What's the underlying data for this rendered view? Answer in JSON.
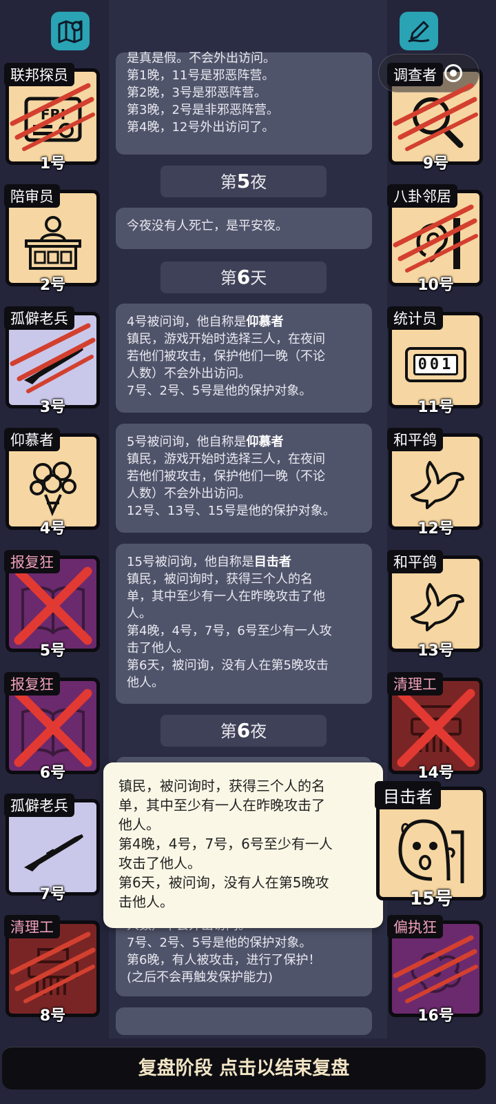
{
  "top": {
    "left_icon": "map-icon",
    "right_icon": "note-edit-icon"
  },
  "capsule": {
    "dots": "•••"
  },
  "cards_left": [
    {
      "label": "联邦探员",
      "num": "1号",
      "art": "fbi-badge-icon",
      "bg": "#f6d6a2",
      "state": "scratched"
    },
    {
      "label": "陪审员",
      "num": "2号",
      "art": "juror-icon",
      "bg": "#f6d6a2",
      "state": "normal"
    },
    {
      "label": "孤僻老兵",
      "num": "3号",
      "art": "rifle-icon",
      "bg": "#c9c8ea",
      "state": "scratched"
    },
    {
      "label": "仰慕者",
      "num": "4号",
      "art": "flower-bouquet-icon",
      "bg": "#f6d6a2",
      "state": "normal"
    },
    {
      "label": "报复狂",
      "num": "5号",
      "art": "book-icon",
      "bg": "#6b2a6d",
      "state": "crossed"
    },
    {
      "label": "报复狂",
      "num": "6号",
      "art": "book-icon",
      "bg": "#6b2a6d",
      "state": "crossed"
    },
    {
      "label": "孤僻老兵",
      "num": "7号",
      "art": "rifle-icon",
      "bg": "#c9c8ea",
      "state": "normal"
    },
    {
      "label": "清理工",
      "num": "8号",
      "art": "shredder-icon",
      "bg": "#7a2525",
      "state": "scratched"
    }
  ],
  "cards_right": [
    {
      "label": "调查者",
      "num": "9号",
      "art": "magnifier-icon",
      "bg": "#f6d6a2",
      "state": "scratched"
    },
    {
      "label": "八卦邻居",
      "num": "10号",
      "art": "ear-wall-icon",
      "bg": "#f6d6a2",
      "state": "scratched"
    },
    {
      "label": "统计员",
      "num": "11号",
      "art": "counter-icon",
      "bg": "#f6d6a2",
      "state": "normal",
      "counter": "001"
    },
    {
      "label": "和平鸽",
      "num": "12号",
      "art": "dove-icon",
      "bg": "#f6d6a2",
      "state": "normal"
    },
    {
      "label": "和平鸽",
      "num": "13号",
      "art": "dove-icon",
      "bg": "#f6d6a2",
      "state": "normal"
    },
    {
      "label": "清理工",
      "num": "14号",
      "art": "shredder-icon",
      "bg": "#7a2525",
      "state": "crossed"
    },
    {
      "label": "目击者",
      "num": "15号",
      "art": "witness-face-icon",
      "bg": "#f6d6a2",
      "state": "normal"
    },
    {
      "label": "偏执狂",
      "num": "16号",
      "art": "paranoid-icon",
      "bg": "#6b2a6d",
      "state": "scratched"
    }
  ],
  "log": {
    "msg0": [
      "是真是假。不会外出访问。",
      "第1晚，11号是邪恶阵营。",
      "第2晚，3号是邪恶阵营。",
      "第3晚，2号是非邪恶阵营。",
      "第4晚，12号外出访问了。"
    ],
    "night5": {
      "pre": "第",
      "n": "5",
      "post": "夜"
    },
    "msg1": "今夜没有人死亡，是平安夜。",
    "day6": {
      "pre": "第",
      "n": "6",
      "post": "天"
    },
    "msg2": {
      "head": "4号被问询，他自称是",
      "role": "仰慕者",
      "lines": [
        "镇民，游戏开始时选择三人，在夜间",
        "若他们被攻击，保护他们一晚（不论",
        "人数）不会外出访问。",
        "7号、2号、5号是他的保护对象。"
      ]
    },
    "msg3": {
      "head": "5号被问询，他自称是",
      "role": "仰慕者",
      "lines": [
        "镇民，游戏开始时选择三人，在夜间",
        "若他们被攻击，保护他们一晚（不论",
        "人数）不会外出访问。",
        "12号、13号、15号是他的保护对象。"
      ]
    },
    "msg4": {
      "head": "15号被问询，他自称是",
      "role": "目击者",
      "lines": [
        "镇民，被问询时，获得三个人的名",
        "单，其中至少有一人在昨晚攻击了他",
        "人。",
        "第4晚，4号，7号，6号至少有一人攻",
        "击了他人。",
        "第6天，被问询，没有人在第5晚攻击",
        "他人。"
      ]
    },
    "night6": {
      "pre": "第",
      "n": "6",
      "post": "夜"
    },
    "msg5": [
      "人数）不会外出访问。",
      "7号、2号、5号是他的保护对象。",
      "第6晚，有人被攻击，进行了保护！",
      "(之后不会再触发保护能力)"
    ]
  },
  "tooltip": [
    "镇民，被问询时，获得三个人的名",
    "单，其中至少有一人在昨晚攻击了",
    "他人。",
    "第4晚，4号，7号，6号至少有一人",
    "攻击了他人。",
    "第6天，被问询，没有人在第5晚攻",
    "击他人。"
  ],
  "bottom_bar": "复盘阶段 点击以结束复盘"
}
